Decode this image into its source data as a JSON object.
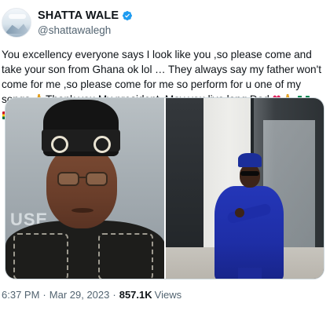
{
  "author": {
    "display_name": "SHATTA WALE",
    "handle": "@shattawalegh",
    "verified": true,
    "avatar_icon": "profile-avatar"
  },
  "tweet": {
    "text": "You excellency everyone says I look like you ,so please come and take your son from Ghana ok lol … They always say my father won't come for me ,so please come for me so perform for u one of my songs",
    "text_tail": "Thank you My president ,May you live long  Dad",
    "emojis": {
      "pray": "🙏",
      "heart": "♥"
    },
    "flags": [
      "flag-nigeria",
      "flag-ghana"
    ]
  },
  "media": {
    "count": 2,
    "left_photo_bg_text": "USE",
    "photos": [
      "portrait-in-black-cap",
      "man-in-blue-agbada"
    ]
  },
  "meta": {
    "time": "6:37 PM",
    "date": "Mar 29, 2023",
    "views_count": "857.1K",
    "views_label": "Views"
  },
  "colors": {
    "accent": "#1d9bf0",
    "secondary_text": "#536471",
    "border": "#cfd9de"
  }
}
